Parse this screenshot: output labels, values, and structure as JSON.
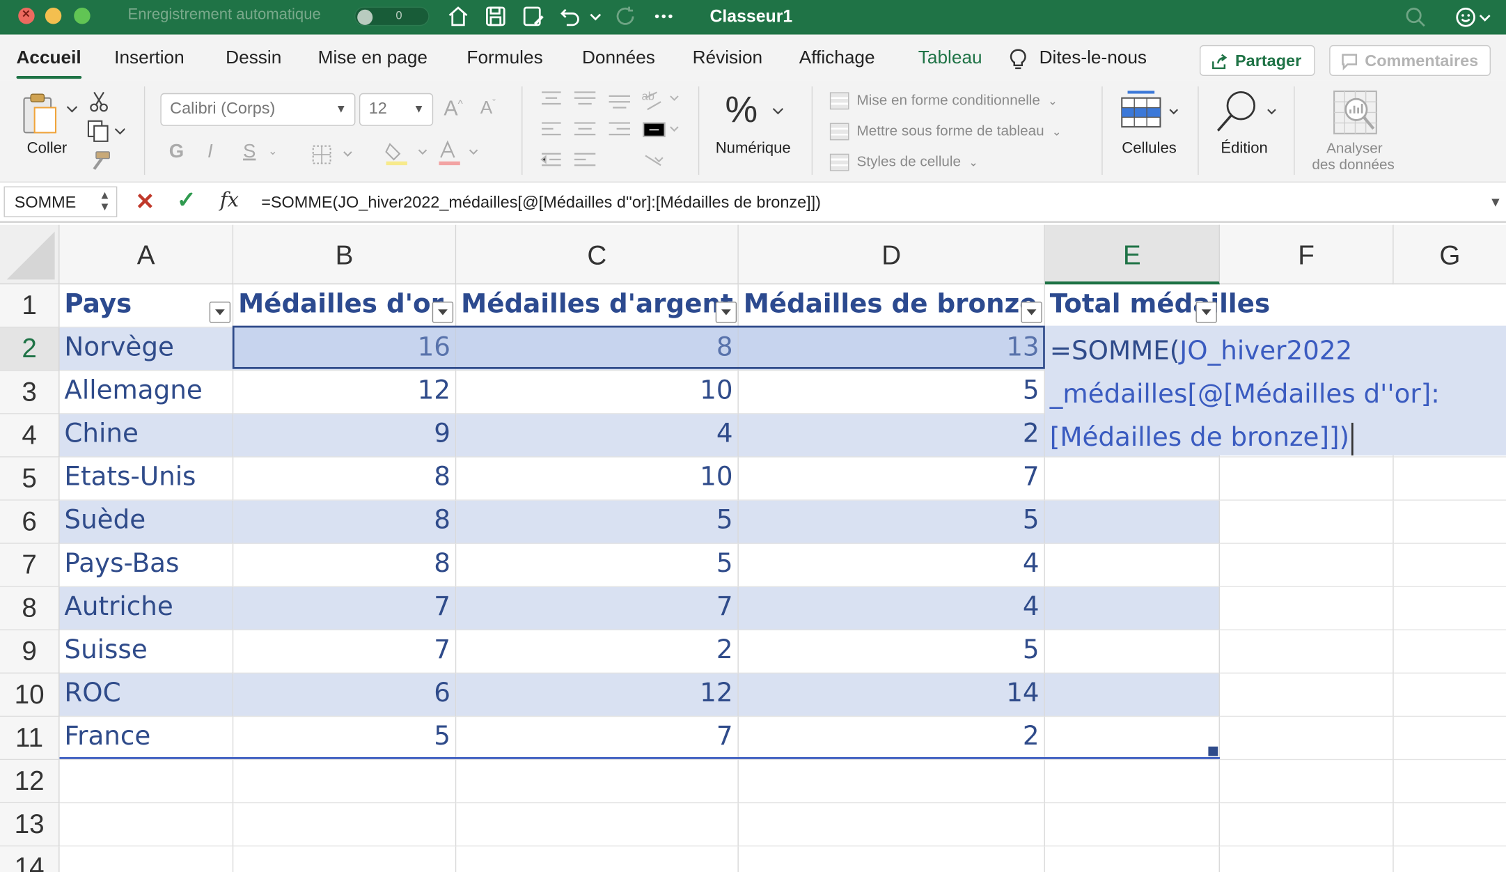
{
  "titlebar": {
    "autosave_label": "Enregistrement automatique",
    "autosave_toggle": "0",
    "document_title": "Classeur1",
    "icons": [
      "home-icon",
      "save-icon",
      "save-as-icon",
      "undo-icon",
      "redo-icon",
      "more-icon",
      "search-icon",
      "smiley-icon"
    ]
  },
  "ribbon_tabs": [
    "Accueil",
    "Insertion",
    "Dessin",
    "Mise en page",
    "Formules",
    "Données",
    "Révision",
    "Affichage",
    "Tableau"
  ],
  "tell_me": "Dites-le-nous",
  "share_label": "Partager",
  "comments_label": "Commentaires",
  "ribbon": {
    "paste_label": "Coller",
    "font_name": "Calibri (Corps)",
    "font_size": "12",
    "bold": "G",
    "italic": "I",
    "underline": "S",
    "number_label": "Numérique",
    "cond_format": "Mise en forme conditionnelle",
    "format_table": "Mettre sous forme de tableau",
    "cell_styles": "Styles de cellule",
    "cells_label": "Cellules",
    "edit_label": "Édition",
    "analyze_line1": "Analyser",
    "analyze_line2": "des données"
  },
  "formula_bar": {
    "name_box": "SOMME",
    "fx": "fx",
    "formula": "=SOMME(JO_hiver2022_médailles[@[Médailles d''or]:[Médailles de bronze]])"
  },
  "columns": [
    "A",
    "B",
    "C",
    "D",
    "E",
    "F",
    "G"
  ],
  "row_numbers": [
    "1",
    "2",
    "3",
    "4",
    "5",
    "6",
    "7",
    "8",
    "9",
    "10",
    "11",
    "12",
    "13",
    "14"
  ],
  "table": {
    "headers": [
      "Pays",
      "Médailles d'or",
      "Médailles d'argent",
      "Médailles de bronze",
      "Total médailles"
    ],
    "rows": [
      [
        "Norvège",
        "16",
        "8",
        "13"
      ],
      [
        "Allemagne",
        "12",
        "10",
        "5"
      ],
      [
        "Chine",
        "9",
        "4",
        "2"
      ],
      [
        "Etats-Unis",
        "8",
        "10",
        "7"
      ],
      [
        "Suède",
        "8",
        "5",
        "5"
      ],
      [
        "Pays-Bas",
        "8",
        "5",
        "4"
      ],
      [
        "Autriche",
        "7",
        "7",
        "4"
      ],
      [
        "Suisse",
        "7",
        "2",
        "5"
      ],
      [
        "ROC",
        "6",
        "12",
        "14"
      ],
      [
        "France",
        "5",
        "7",
        "2"
      ]
    ]
  },
  "editing_cell": {
    "line1_eq": "=SOMME(",
    "line1_ref": "JO_hiver2022",
    "line2": "_médailles[@[Médailles d''or]:",
    "line3": "[Médailles de bronze]])"
  },
  "colors": {
    "excel_green": "#1f7346",
    "table_band": "#d9e1f2",
    "table_text": "#2f4b8a",
    "formula_ref": "#3a5bc0"
  }
}
